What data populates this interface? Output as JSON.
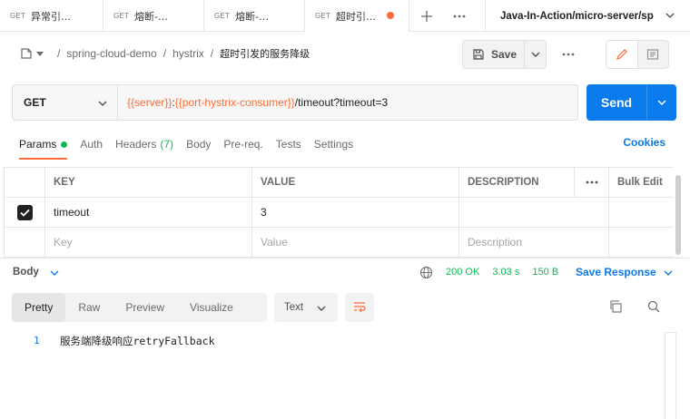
{
  "tabs": [
    {
      "method": "GET",
      "title": "异常引…"
    },
    {
      "method": "GET",
      "title": "熔断-…"
    },
    {
      "method": "GET",
      "title": "熔断-…"
    },
    {
      "method": "GET",
      "title": "超时引…"
    }
  ],
  "environment": "Java-In-Action/micro-server/sp",
  "breadcrumb": {
    "collection": "spring-cloud-demo",
    "folder": "hystrix",
    "request": "超时引发的服务降级"
  },
  "toolbar": {
    "save_label": "Save"
  },
  "request": {
    "method": "GET",
    "url_parts": [
      {
        "text": "{{server}}",
        "kind": "var"
      },
      {
        "text": ":",
        "kind": "plain"
      },
      {
        "text": "{{port-hystrix-consumer}}",
        "kind": "var"
      },
      {
        "text": "/timeout?timeout=3",
        "kind": "plain"
      }
    ],
    "send_label": "Send"
  },
  "request_tabs": {
    "params": "Params",
    "auth": "Auth",
    "headers": "Headers",
    "headers_count": "(7)",
    "body": "Body",
    "prereq": "Pre-req.",
    "tests": "Tests",
    "settings": "Settings",
    "cookies": "Cookies"
  },
  "params_table": {
    "headers": {
      "key": "KEY",
      "value": "VALUE",
      "description": "DESCRIPTION",
      "bulk_edit": "Bulk Edit"
    },
    "rows": [
      {
        "key": "timeout",
        "value": "3",
        "description": "",
        "checked": true
      }
    ],
    "placeholders": {
      "key": "Key",
      "value": "Value",
      "description": "Description"
    }
  },
  "response": {
    "body_label": "Body",
    "status": "200 OK",
    "time": "3.03 s",
    "size": "150 B",
    "save_label": "Save Response",
    "views": [
      "Pretty",
      "Raw",
      "Preview",
      "Visualize"
    ],
    "active_view": "Pretty",
    "format": "Text",
    "line_number": "1",
    "content": "服务端降级响应retryFallback"
  },
  "colors": {
    "accent": "#ff6c37",
    "primary": "#097bed",
    "success": "#0cbb52"
  }
}
